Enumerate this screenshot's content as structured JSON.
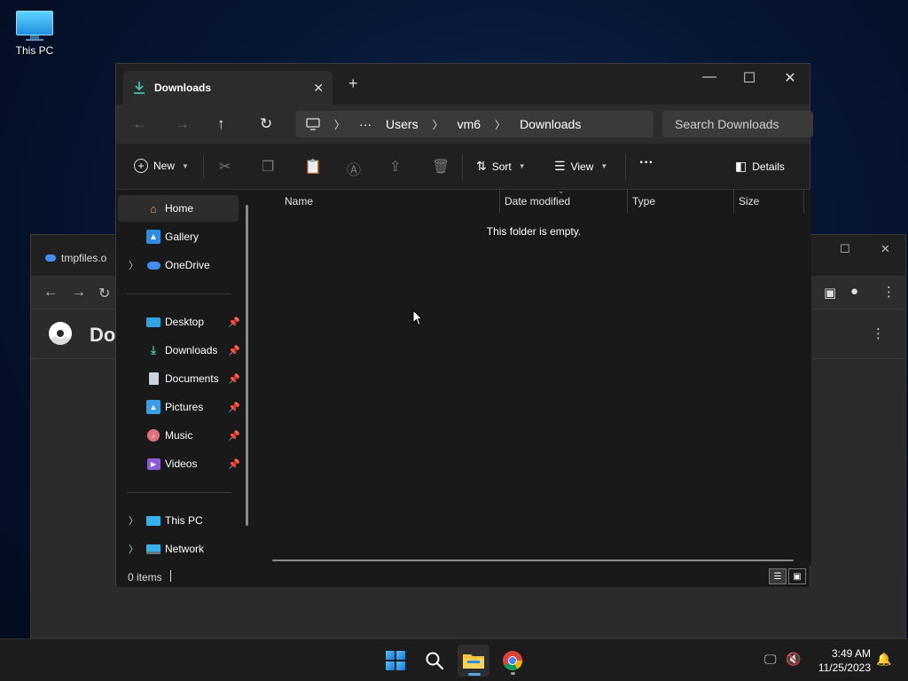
{
  "desktop": {
    "icon_label": "This PC"
  },
  "background_window": {
    "tab_title": "tmpfiles.o",
    "page_title": "Do"
  },
  "explorer": {
    "tab_title": "Downloads",
    "new_tab_symbol": "+",
    "close_tab_symbol": "✕",
    "window_controls": {
      "minimize": "—",
      "maximize": "☐",
      "close": "✕"
    },
    "nav": {
      "back": "←",
      "forward": "→",
      "up": "↑",
      "refresh": "↻"
    },
    "breadcrumb": {
      "overflow": "···",
      "items": [
        "Users",
        "vm6",
        "Downloads"
      ]
    },
    "search_placeholder": "Search Downloads",
    "commandbar": {
      "new_label": "New",
      "sort_label": "Sort",
      "view_label": "View",
      "more_label": "···",
      "details_label": "Details"
    },
    "sidebar": {
      "home": "Home",
      "gallery": "Gallery",
      "onedrive": "OneDrive",
      "desktop": "Desktop",
      "downloads": "Downloads",
      "documents": "Documents",
      "pictures": "Pictures",
      "music": "Music",
      "videos": "Videos",
      "this_pc": "This PC",
      "network": "Network"
    },
    "columns": {
      "name": "Name",
      "date_modified": "Date modified",
      "type": "Type",
      "size": "Size"
    },
    "empty_message": "This folder is empty.",
    "status": {
      "item_count": "0 items"
    }
  },
  "taskbar": {
    "time": "3:49 AM",
    "date": "11/25/2023"
  },
  "colors": {
    "accent": "#58a6e8",
    "window_bg": "#191919",
    "titlebar_bg": "#202020"
  }
}
